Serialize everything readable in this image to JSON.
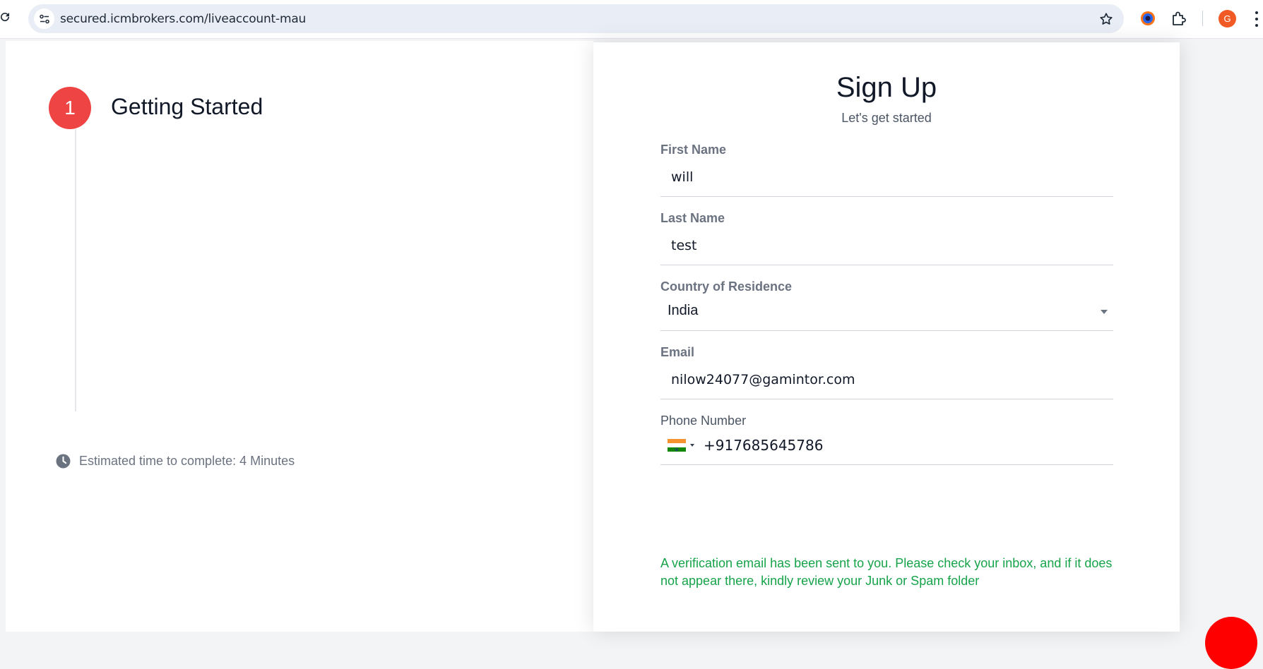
{
  "browser": {
    "url": "secured.icmbrokers.com/liveaccount-mau",
    "profile_initial": "G",
    "icons": [
      "reload-icon",
      "site-info-icon",
      "bookmark-star-icon",
      "color-extension-icon",
      "puzzle-extensions-icon",
      "profile-avatar",
      "more-menu-icon"
    ]
  },
  "progress": {
    "step_number": "1",
    "step_title": "Getting Started",
    "estimate_text": "Estimated time to complete: 4 Minutes"
  },
  "form": {
    "title": "Sign Up",
    "subtitle": "Let's get started",
    "first_name": {
      "label": "First Name",
      "value": "will"
    },
    "last_name": {
      "label": "Last Name",
      "value": "test"
    },
    "country": {
      "label": "Country of Residence",
      "value": "India"
    },
    "email": {
      "label": "Email",
      "value": "nilow24077@gamintor.com"
    },
    "phone": {
      "label": "Phone Number",
      "country_flag": "india-flag-icon",
      "value": "+917685645786"
    },
    "notice": "A verification email has been sent to you. Please check your inbox, and if it does not appear there, kindly review your Junk or Spam folder"
  },
  "colors": {
    "step_accent": "#ef4444",
    "notice_green": "#16a34a",
    "fab_red": "#ff0000"
  }
}
